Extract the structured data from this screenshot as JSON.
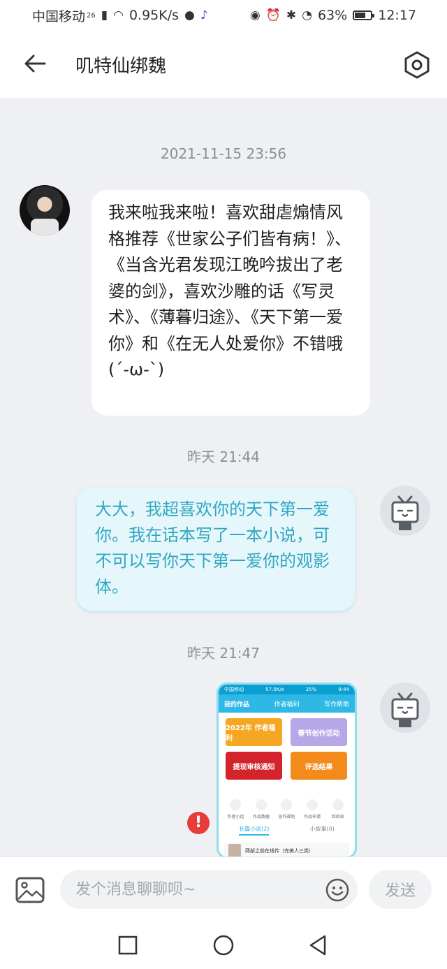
{
  "status_bar": {
    "carrier": "中国移动",
    "network": "26",
    "speed": "0.95K/s",
    "battery": "63%",
    "time": "12:17",
    "icons": [
      "signal-icon",
      "wifi-icon",
      "qq-icon",
      "music-icon",
      "eye-icon",
      "alarm-icon",
      "bluetooth-icon",
      "speedometer-icon",
      "battery-icon"
    ]
  },
  "header": {
    "title": "叽特仙绑魏",
    "back_icon": "arrow-left-icon",
    "settings_icon": "hexagon-settings-icon"
  },
  "messages": [
    {
      "timestamp": "2021-11-15 23:56",
      "direction": "incoming",
      "text": "我来啦我来啦！喜欢甜虐煽情风格推荐《世家公子们皆有病！》、《当含光君发现江晚吟拔出了老婆的剑》，喜欢沙雕的话《写灵术》、《薄暮归途》、《天下第一爱你》和《在无人处爱你》不错哦(´-ω-`)"
    },
    {
      "timestamp": "昨天 21:44",
      "direction": "outgoing",
      "text": "大大，我超喜欢你的天下第一爱你。我在话本写了一本小说，可不可以写你天下第一爱你的观影体。"
    },
    {
      "timestamp": "昨天 21:47",
      "direction": "outgoing",
      "type": "image",
      "status": "failed",
      "preview": {
        "status_left": "中国移动",
        "status_speed": "57.0K/s",
        "status_battery": "35%",
        "status_time": "9:44",
        "tabs": [
          "我的作品",
          "作者福利",
          "写作帮助"
        ],
        "cards": [
          "2022年 作者福利",
          "春节创作活动",
          "提现审核通知",
          "评选结果"
        ],
        "card_colors": [
          "#f5a623",
          "#b7a6e8",
          "#d2242a",
          "#f28b1c"
        ],
        "icons": [
          "作者小组",
          "作品数据",
          "创作福利",
          "作品申请",
          "回收站"
        ],
        "subtabs": [
          "长篇小说(2)",
          "小故事(0)"
        ],
        "list_item": "两部之前在线传（完美人三类）"
      }
    }
  ],
  "input": {
    "placeholder": "发个消息聊聊呗~",
    "value": "",
    "send_label": "发送"
  },
  "colors": {
    "background": "#eef0f3",
    "outgoing_bubble": "#e6f7fb",
    "outgoing_text": "#2fa7c0",
    "error": "#e83b3b"
  }
}
